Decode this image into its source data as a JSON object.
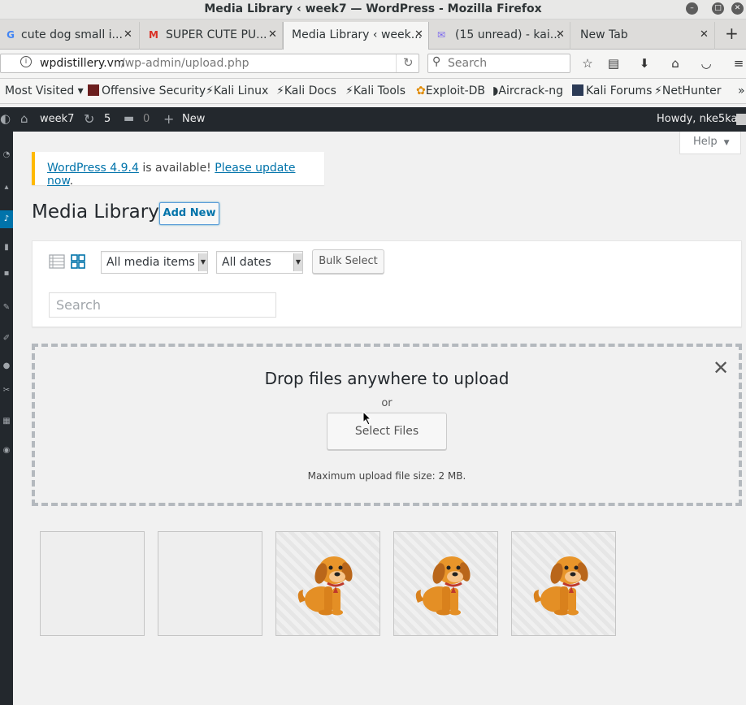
{
  "window": {
    "title": "Media Library ‹ week7 — WordPress - Mozilla Firefox"
  },
  "tabs": [
    {
      "label": "cute dog small i...",
      "icon": "google-icon"
    },
    {
      "label": "SUPER CUTE PU...",
      "icon": "gmail-icon"
    },
    {
      "label": "Media Library ‹ week...",
      "icon": "none",
      "active": true
    },
    {
      "label": "(15 unread) - kai...",
      "icon": "mail-icon"
    },
    {
      "label": "New Tab",
      "icon": "none"
    }
  ],
  "nav": {
    "url_host": "wpdistillery.vm",
    "url_path": "/wp-admin/upload.php",
    "search_placeholder": "Search"
  },
  "bookmarks": [
    "Most Visited",
    "Offensive Security",
    "Kali Linux",
    "Kali Docs",
    "Kali Tools",
    "Exploit-DB",
    "Aircrack-ng",
    "Kali Forums",
    "NetHunter"
  ],
  "adminbar": {
    "site": "week7",
    "updates": "5",
    "comments": "0",
    "new": "New",
    "howdy": "Howdy, nke5ka"
  },
  "help": {
    "label": "Help"
  },
  "notice": {
    "link1": "WordPress 4.9.4",
    "middle": " is available! ",
    "link2": "Please update now",
    "end": "."
  },
  "page": {
    "title": "Media Library",
    "add_new": "Add New"
  },
  "filters": {
    "media_type": "All media items",
    "dates": "All dates",
    "bulk": "Bulk Select",
    "search_placeholder": "Search"
  },
  "dropzone": {
    "title": "Drop files anywhere to upload",
    "or": "or",
    "button": "Select Files",
    "max": "Maximum upload file size: 2 MB."
  },
  "thumbnails": [
    {
      "type": "empty"
    },
    {
      "type": "empty"
    },
    {
      "type": "dog-image"
    },
    {
      "type": "dog-image"
    },
    {
      "type": "dog-image"
    }
  ],
  "colors": {
    "accent": "#0073aa",
    "adminbar": "#23282d",
    "notice": "#ffb900"
  }
}
